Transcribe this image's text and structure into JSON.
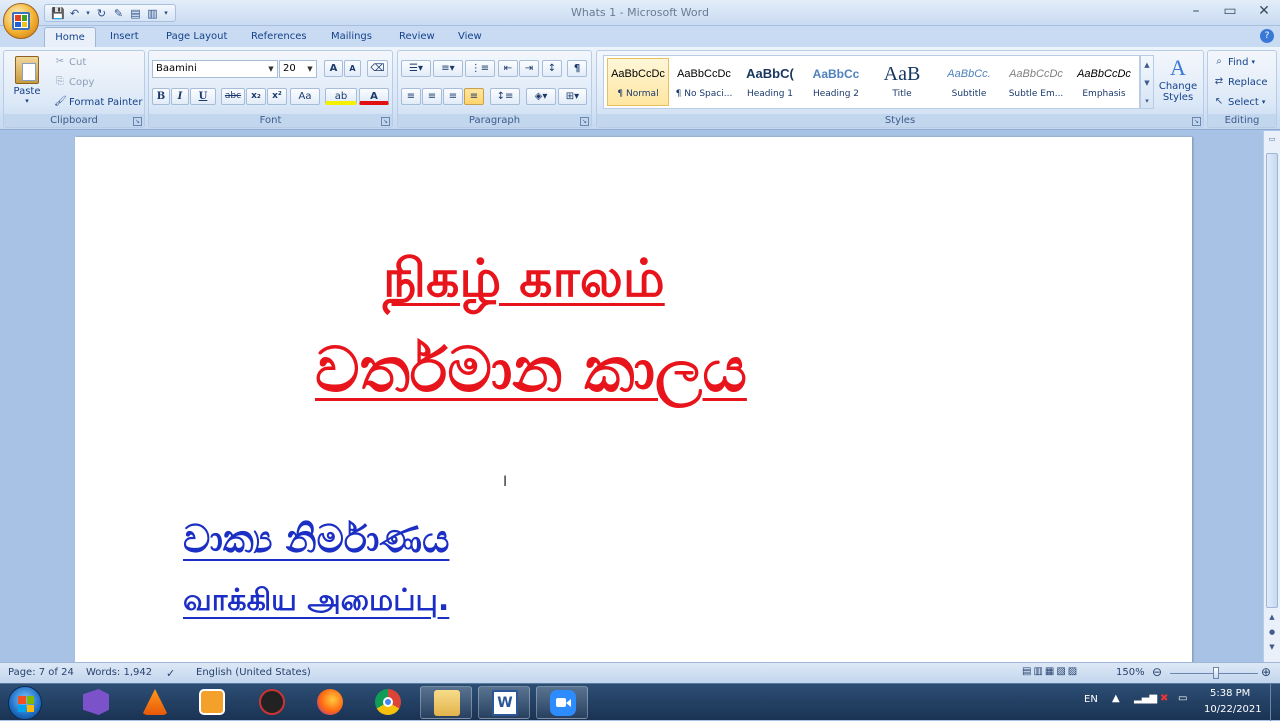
{
  "window": {
    "title": "Whats 1 - Microsoft Word",
    "controls": [
      "–",
      "▭",
      "✕"
    ]
  },
  "tabs": [
    "Home",
    "Insert",
    "Page Layout",
    "References",
    "Mailings",
    "Review",
    "View"
  ],
  "ribbon": {
    "clipboard": {
      "label": "Clipboard",
      "paste": "Paste",
      "cut": "Cut",
      "copy": "Copy",
      "format_painter": "Format Painter"
    },
    "font": {
      "label": "Font",
      "family": "Baamini",
      "size": "20",
      "grow": "A",
      "shrink": "A",
      "bold": "B",
      "italic": "I",
      "underline": "U",
      "strikethrough": "abc",
      "subscript": "x₂",
      "superscript": "x²",
      "change_case": "Aa",
      "highlight": "ab",
      "font_color": "A"
    },
    "paragraph": {
      "label": "Paragraph",
      "show_marks": "¶"
    },
    "styles": {
      "label": "Styles",
      "items": [
        {
          "preview": "AaBbCcDc",
          "name": "¶ Normal",
          "active": true
        },
        {
          "preview": "AaBbCcDc",
          "name": "¶ No Spaci..."
        },
        {
          "preview": "AaBbC(",
          "name": "Heading 1"
        },
        {
          "preview": "AaBbCc",
          "name": "Heading 2"
        },
        {
          "preview": "AaB",
          "name": "Title"
        },
        {
          "preview": "AaBbCc.",
          "name": "Subtitle"
        },
        {
          "preview": "AaBbCcDc",
          "name": "Subtle Em..."
        },
        {
          "preview": "AaBbCcDc",
          "name": "Emphasis"
        }
      ],
      "change_styles": "Change Styles"
    },
    "editing": {
      "label": "Editing",
      "find": "Find",
      "replace": "Replace",
      "select": "Select"
    }
  },
  "document": {
    "lines": [
      {
        "text": "நிகழ் காலம்",
        "color": "#e8141b"
      },
      {
        "text": "වර්තමාන කාලය",
        "color": "#e8141b"
      },
      {
        "text": "වාක්‍ය නිර්මාණය",
        "color": "#1c2fc4"
      },
      {
        "text": "வாக்கிய அமைப்பு.",
        "color": "#1c2fc4"
      }
    ]
  },
  "status": {
    "page": "Page: 7 of 24",
    "words": "Words: 1,942",
    "language": "English (United States)",
    "zoom": "150%"
  },
  "taskbar": {
    "apps": [
      "visual-studio",
      "vlc",
      "media-player",
      "chess",
      "firefox",
      "chrome",
      "file-explorer",
      "word",
      "zoom"
    ],
    "language": "EN",
    "time": "5:38 PM",
    "date": "10/22/2021"
  }
}
